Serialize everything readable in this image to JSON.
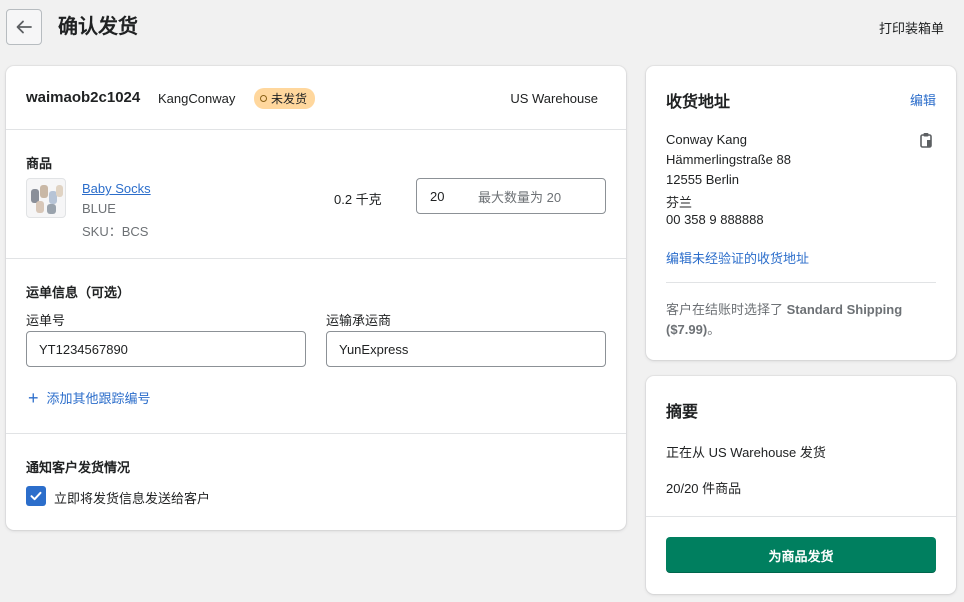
{
  "header": {
    "title": "确认发货",
    "print_label": "打印装箱单"
  },
  "order": {
    "id": "waimaob2c1024",
    "customer": "KangConway",
    "status": "未发货",
    "warehouse": "US Warehouse"
  },
  "products": {
    "section_title": "商品",
    "item": {
      "name": "Baby Socks",
      "variant": "BLUE",
      "sku": "SKU：BCS",
      "weight": "0.2 千克",
      "quantity": "20",
      "max_quantity": "最大数量为 20"
    }
  },
  "tracking": {
    "section_title": "运单信息（可选）",
    "number_label": "运单号",
    "number_value": "YT1234567890",
    "carrier_label": "运输承运商",
    "carrier_value": "YunExpress",
    "add_label": "添加其他跟踪编号"
  },
  "notify": {
    "section_title": "通知客户发货情况",
    "checkbox_label": "立即将发货信息发送给客户",
    "checked": true
  },
  "address": {
    "title": "收货地址",
    "edit_label": "编辑",
    "lines": [
      "Conway Kang",
      "Hämmerlingstraße 88",
      "12555 Berlin",
      "芬兰",
      "00 358 9 888888"
    ],
    "edit_unverified": "编辑未经验证的收货地址",
    "shipping_prefix": "客户在结账时选择了 ",
    "shipping_method": "Standard Shipping",
    "shipping_price": "($7.99)",
    "shipping_suffix": "。"
  },
  "summary": {
    "title": "摘要",
    "from": "正在从 US Warehouse 发货",
    "count": "20/20 件商品",
    "ship_button": "为商品发货"
  },
  "colors": {
    "primary": "#007f5f",
    "link": "#2c6ecb",
    "badge_bg": "#ffd79d"
  }
}
